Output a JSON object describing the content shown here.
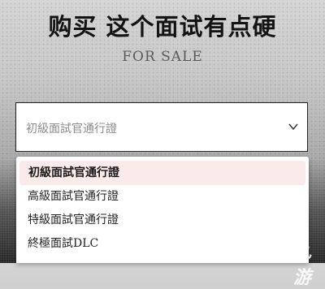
{
  "header": {
    "title": "购买 这个面试有点硬",
    "subtitle": "FOR SALE"
  },
  "select": {
    "value": "初級面試官通行證"
  },
  "dropdown": {
    "options": [
      "初級面試官通行證",
      "高級面試官通行證",
      "特級面試官通行證",
      "終極面試DLC"
    ],
    "selected_index": 0
  },
  "watermark": {
    "text": "九游"
  },
  "colors": {
    "selected_bg": "#faeaea",
    "title": "#141414"
  }
}
